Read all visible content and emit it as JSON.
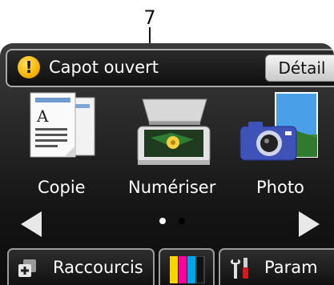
{
  "callout": {
    "number": "7"
  },
  "status": {
    "message": "Capot ouvert",
    "detail_label": "Détail",
    "icon": "warning-icon"
  },
  "tiles": [
    {
      "label": "Copie",
      "icon": "copy-icon"
    },
    {
      "label": "Numériser",
      "icon": "scanner-icon"
    },
    {
      "label": "Photo",
      "icon": "camera-icon"
    }
  ],
  "pager": {
    "pages": 2,
    "active_page": 1
  },
  "bottom_bar": {
    "shortcuts_label": "Raccourcis",
    "ink_colors": [
      "#f5d400",
      "#ff00a0",
      "#00a6e8",
      "#111111"
    ],
    "settings_label": "Param"
  },
  "colors": {
    "screen_bg": "#1a1a1a",
    "warning": "#f5b400",
    "text": "#ffffff"
  }
}
